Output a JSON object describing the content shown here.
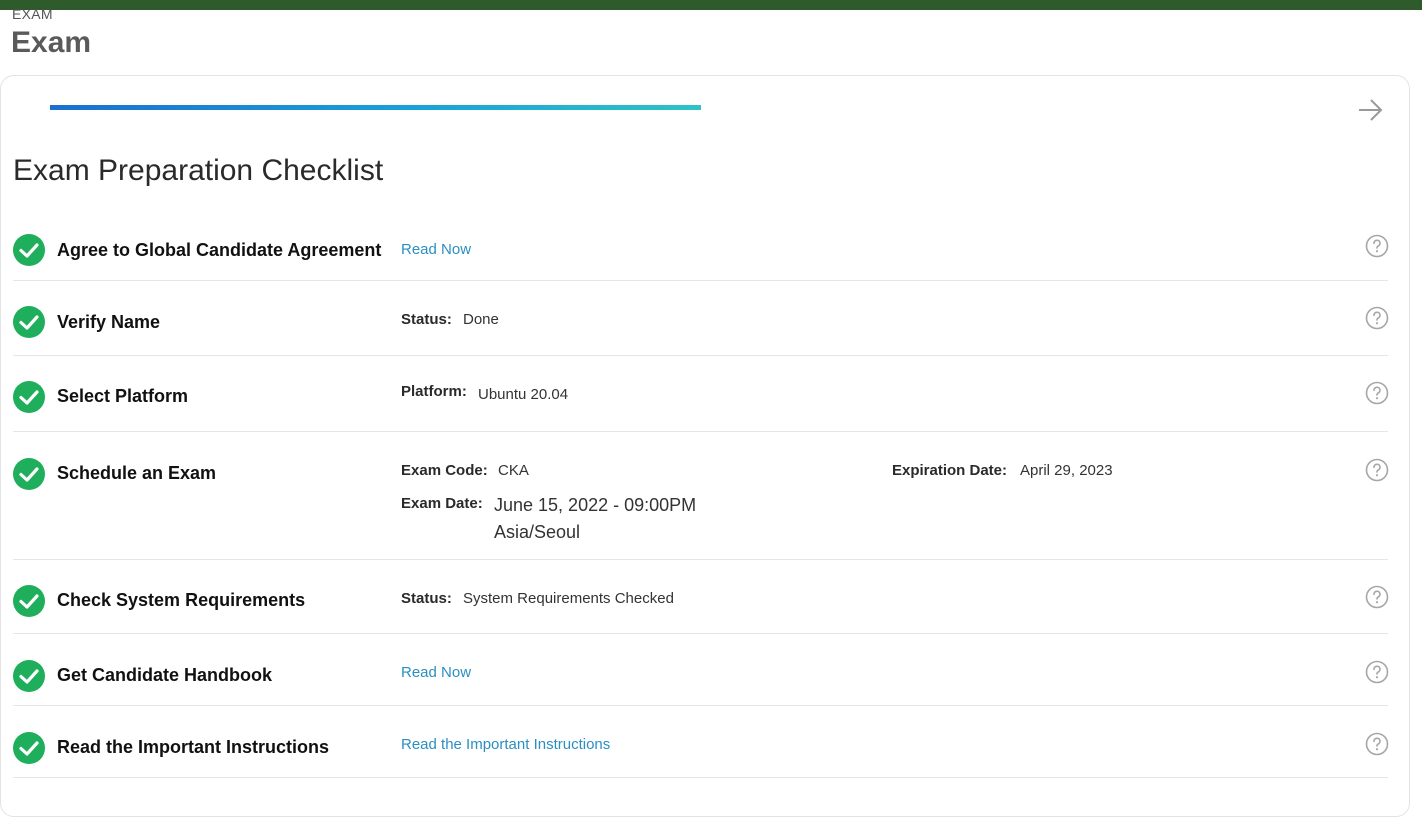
{
  "header": {
    "eyebrow": "EXAM",
    "title": "Exam"
  },
  "checklist": {
    "title": "Exam Preparation Checklist",
    "items": [
      {
        "label": "Agree to Global Candidate Agreement",
        "link": "Read Now"
      },
      {
        "label": "Verify Name",
        "status_key": "Status:",
        "status_value": "Done"
      },
      {
        "label": "Select Platform",
        "platform_key": "Platform:",
        "platform_value": "Ubuntu 20.04"
      },
      {
        "label": "Schedule an Exam",
        "code_key": "Exam Code:",
        "code_value": "CKA",
        "expiration_key": "Expiration Date:",
        "expiration_value": "April 29, 2023",
        "date_key": "Exam Date:",
        "date_value": "June 15, 2022 - 09:00PM",
        "timezone": "Asia/Seoul"
      },
      {
        "label": "Check System Requirements",
        "status_key": "Status:",
        "status_value": "System Requirements Checked"
      },
      {
        "label": "Get Candidate Handbook",
        "link": "Read Now"
      },
      {
        "label": "Read the Important Instructions",
        "link": "Read the Important Instructions"
      }
    ]
  },
  "icons": {
    "check": "check-circle-icon",
    "help": "question-circle-icon",
    "next": "arrow-right-icon"
  },
  "colors": {
    "topbar": "#2f5b2c",
    "check_green": "#1fae5b",
    "link_blue": "#2b8fc0",
    "progress_start": "#1a6fd0",
    "progress_end": "#2ec3c6"
  }
}
